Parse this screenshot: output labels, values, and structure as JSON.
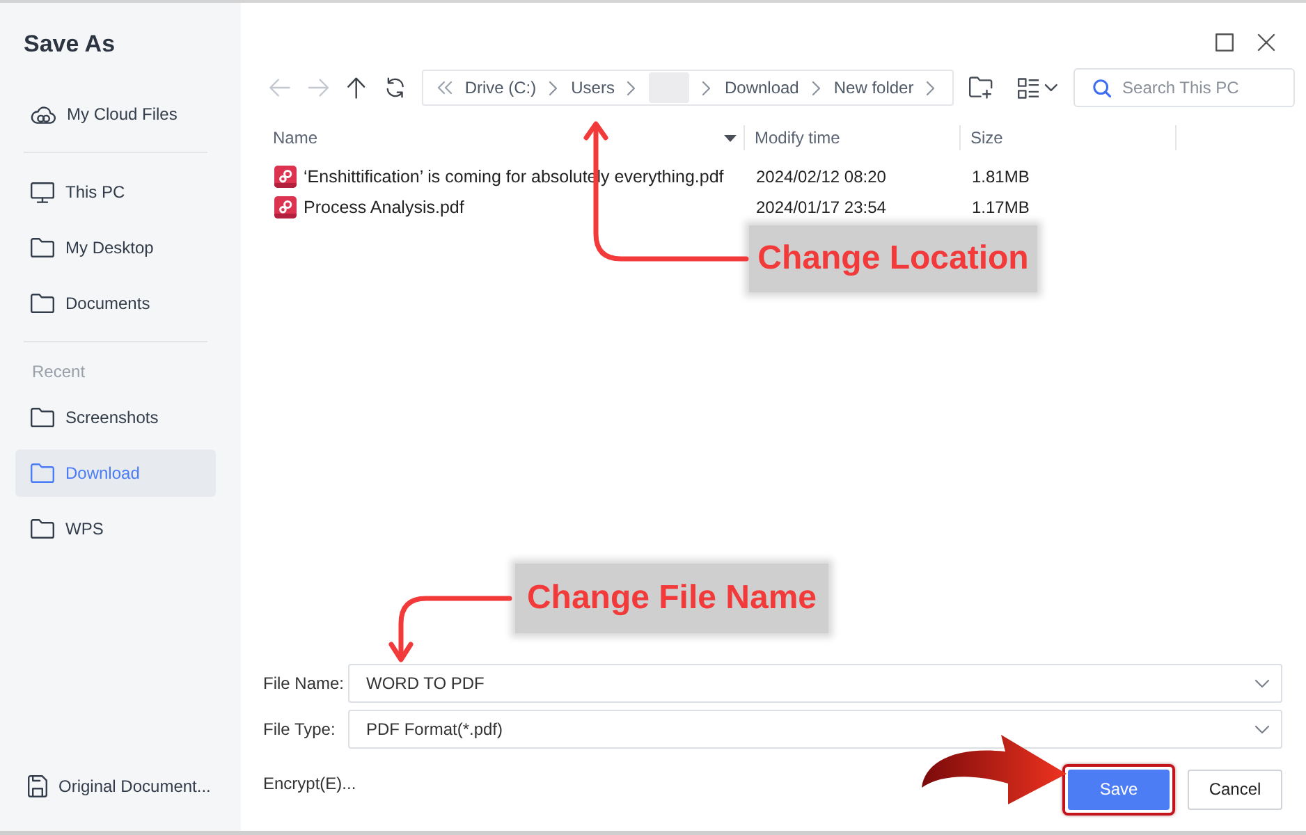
{
  "window": {
    "title": "Save As"
  },
  "sidebar": {
    "groups": [
      {
        "items": [
          {
            "kind": "cloud",
            "label": "My Cloud Files",
            "selected": false
          }
        ]
      },
      {
        "items": [
          {
            "kind": "computer",
            "label": "This PC",
            "selected": false
          },
          {
            "kind": "folder",
            "label": "My Desktop",
            "selected": false
          },
          {
            "kind": "folder",
            "label": "Documents",
            "selected": false
          }
        ]
      },
      {
        "heading": "Recent",
        "items": [
          {
            "kind": "folder",
            "label": "Screenshots",
            "selected": false
          },
          {
            "kind": "folder",
            "label": "Download",
            "selected": true
          },
          {
            "kind": "folder",
            "label": "WPS",
            "selected": false
          }
        ]
      }
    ],
    "footer": {
      "label": "Original Document..."
    }
  },
  "toolbar": {
    "nav": [
      {
        "kind": "back",
        "disabled": true
      },
      {
        "kind": "forward",
        "disabled": true
      },
      {
        "kind": "up",
        "disabled": false
      },
      {
        "kind": "refresh",
        "disabled": false
      }
    ],
    "breadcrumb": [
      {
        "kind": "crumb",
        "label": "Drive (C:)"
      },
      {
        "kind": "crumb",
        "label": "Users"
      },
      {
        "kind": "redacted"
      },
      {
        "kind": "crumb",
        "label": "Download"
      },
      {
        "kind": "crumb",
        "label": "New folder"
      }
    ],
    "search": {
      "placeholder": "Search This PC"
    }
  },
  "table": {
    "columns": [
      {
        "label": "Name",
        "sorted": true
      },
      {
        "label": "Modify time",
        "sorted": false
      },
      {
        "label": "Size",
        "sorted": false
      }
    ],
    "rows": [
      {
        "name": "‘Enshittification’ is coming for absolutely everything.pdf",
        "modified": "2024/02/12 08:20",
        "size": "1.81MB",
        "selected": false
      },
      {
        "name": "Process Analysis.pdf",
        "modified": "2024/01/17 23:54",
        "size": "1.17MB",
        "selected": false
      }
    ]
  },
  "form": {
    "fields": [
      {
        "label": "File Name:",
        "value": "WORD TO PDF"
      },
      {
        "label": "File Type:",
        "value": "PDF Format(*.pdf)"
      }
    ],
    "link": "Encrypt(E)...",
    "buttons": [
      {
        "kind": "primary",
        "label": "Save",
        "highlighted": true
      },
      {
        "kind": "secondary",
        "label": "Cancel",
        "highlighted": false
      }
    ]
  },
  "annotations": [
    {
      "kind": "callout",
      "text": "Change Location"
    },
    {
      "kind": "callout",
      "text": "Change File Name"
    },
    {
      "kind": "pointer"
    }
  ]
}
